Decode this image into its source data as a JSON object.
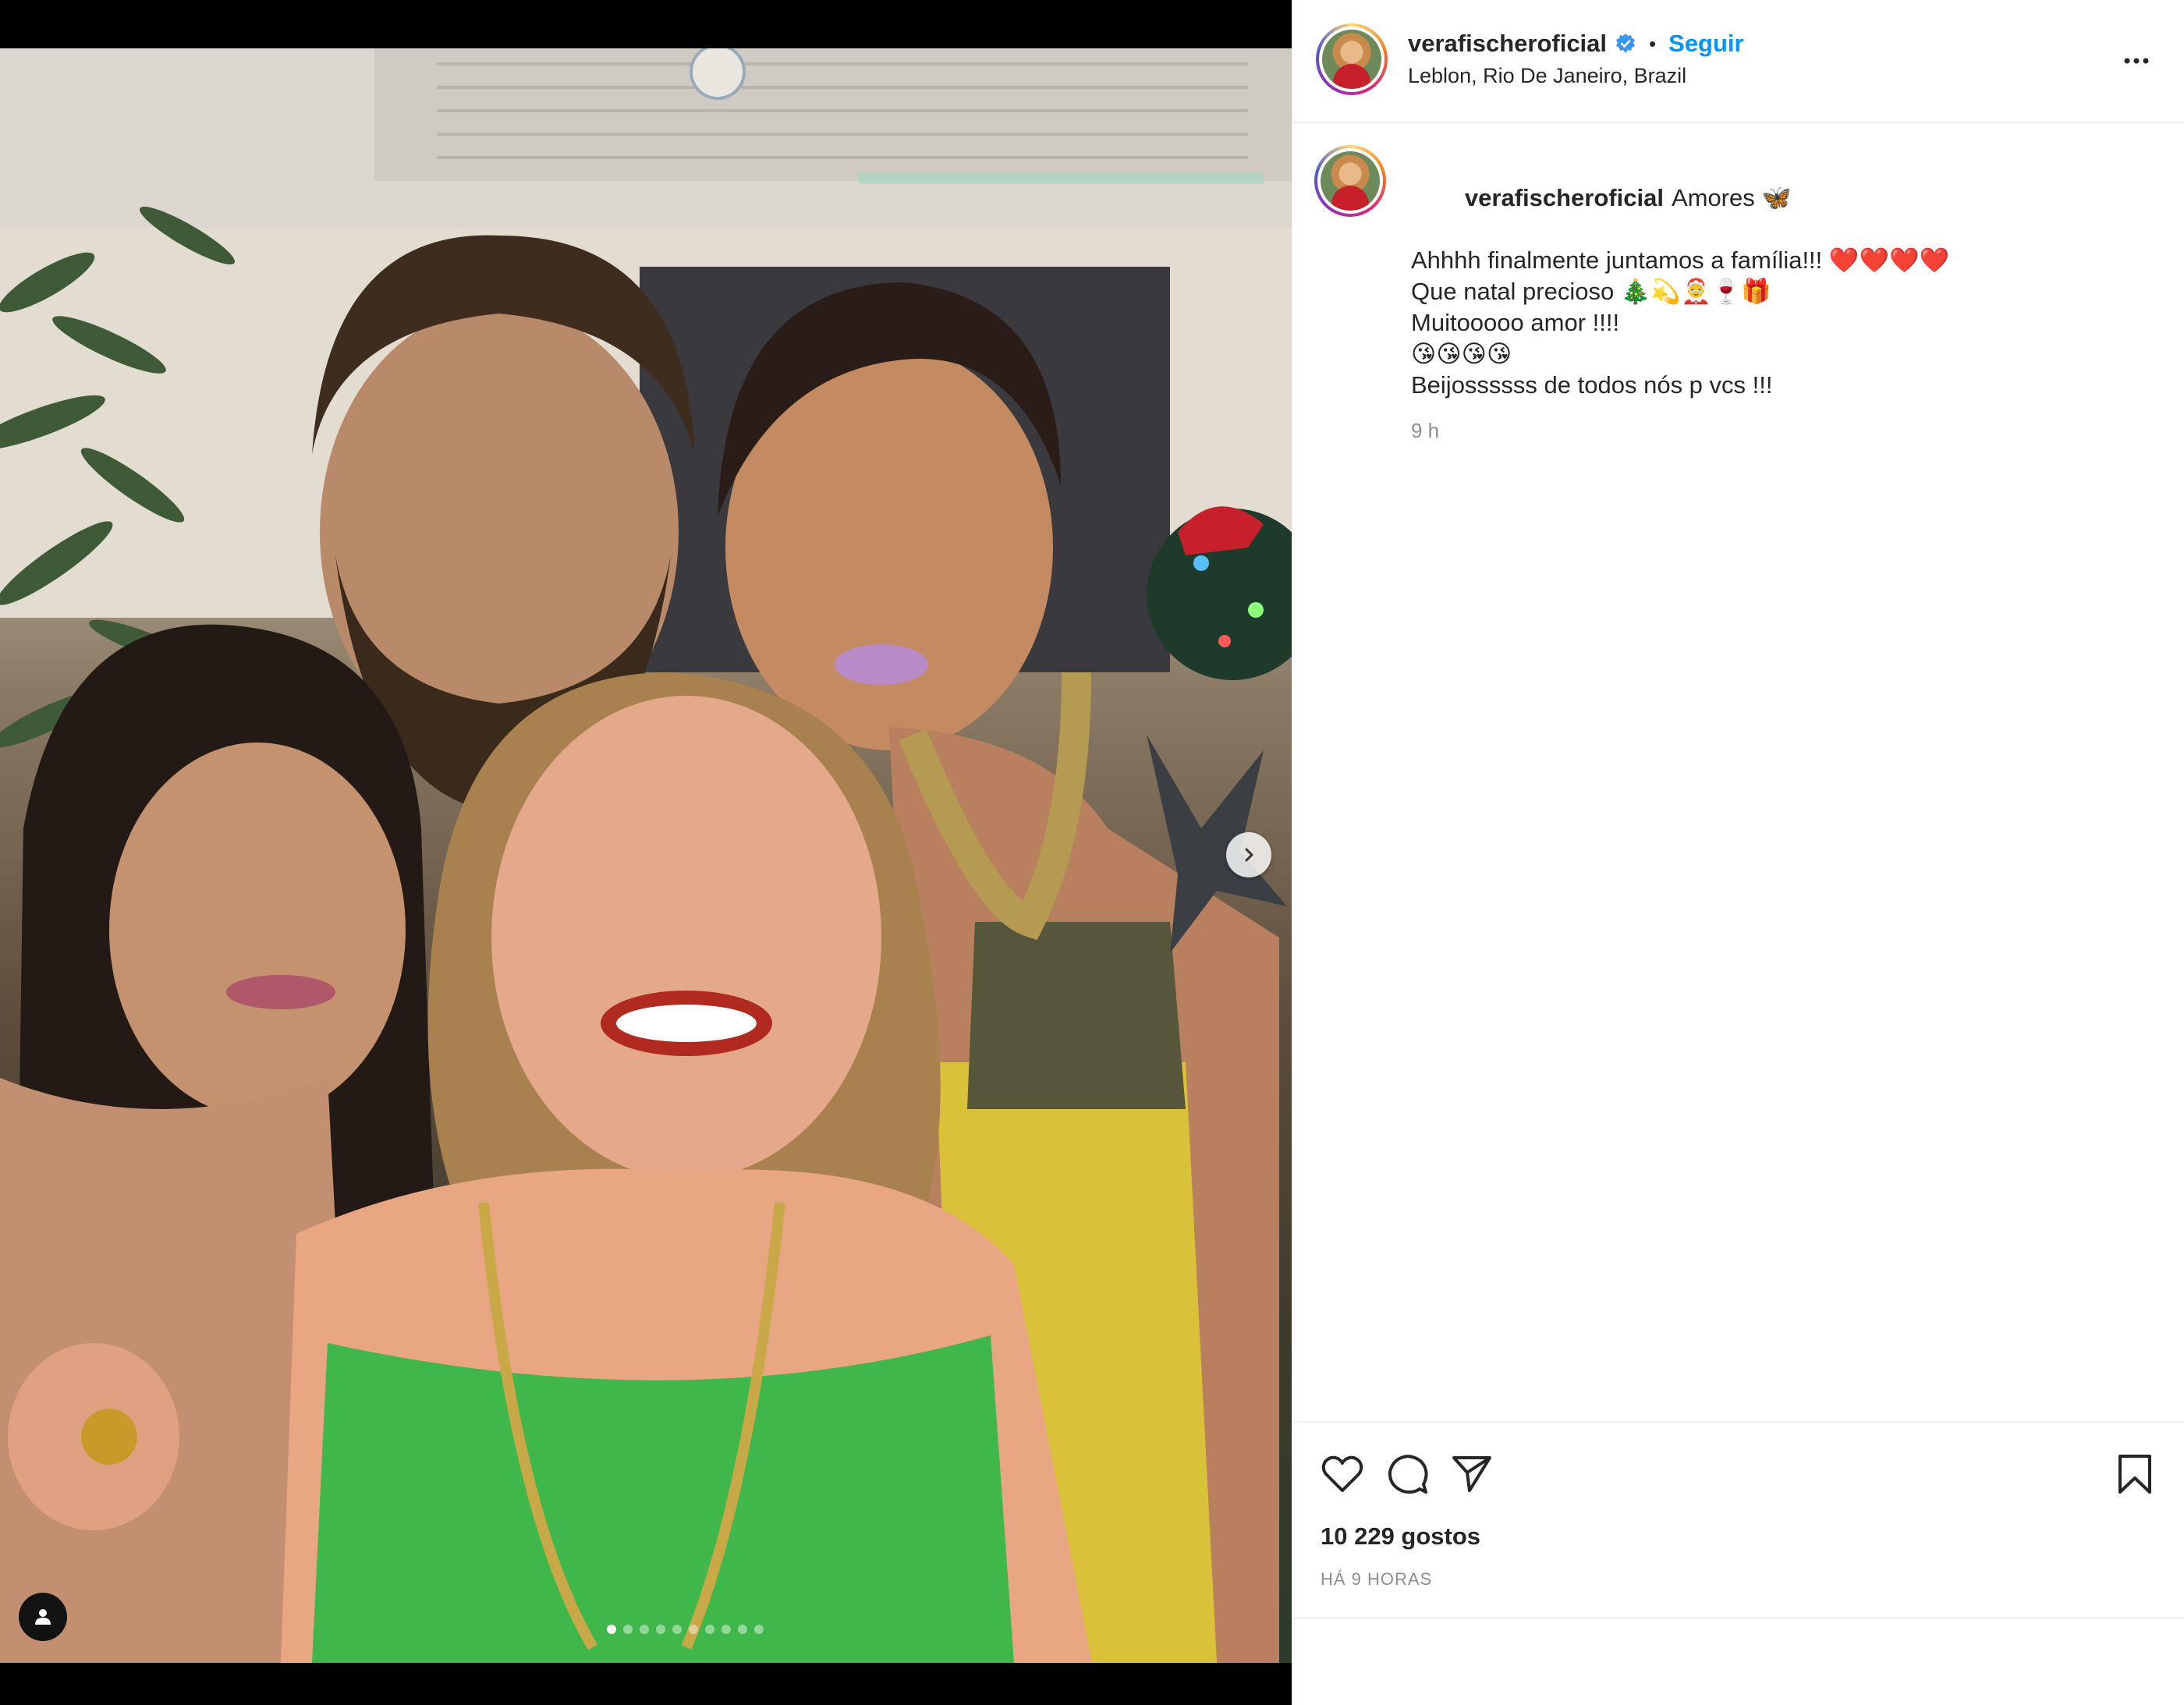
{
  "post": {
    "username": "verafischeroficial",
    "follow_label": "Seguir",
    "location": "Leblon, Rio De Janeiro, Brazil",
    "more_label": "…"
  },
  "caption": {
    "username": "verafischeroficial",
    "lines": [
      "Amores 🦋",
      "Ahhhh finalmente juntamos a família!!! ❤️❤️❤️❤️",
      "Que natal precioso 🎄💫🤶🍷🎁",
      "Muitooooo amor !!!!",
      "😘😘😘😘",
      "Beijossssss de todos nós p vcs !!!"
    ],
    "time": "9 h"
  },
  "engagement": {
    "likes": "10 229 gostos",
    "timestamp": "HÁ 9 HORAS"
  },
  "carousel": {
    "total": 10,
    "current": 1
  },
  "colors": {
    "accent": "#0095f6",
    "text": "#262626",
    "muted": "#8e8e8e",
    "divider": "#efefef"
  },
  "icons": {
    "like": "heart-icon",
    "comment": "comment-icon",
    "share": "send-icon",
    "save": "bookmark-icon",
    "tag": "user-tag-icon",
    "next": "chevron-right-icon",
    "verified": "verified-badge-icon",
    "more": "more-options-icon"
  }
}
